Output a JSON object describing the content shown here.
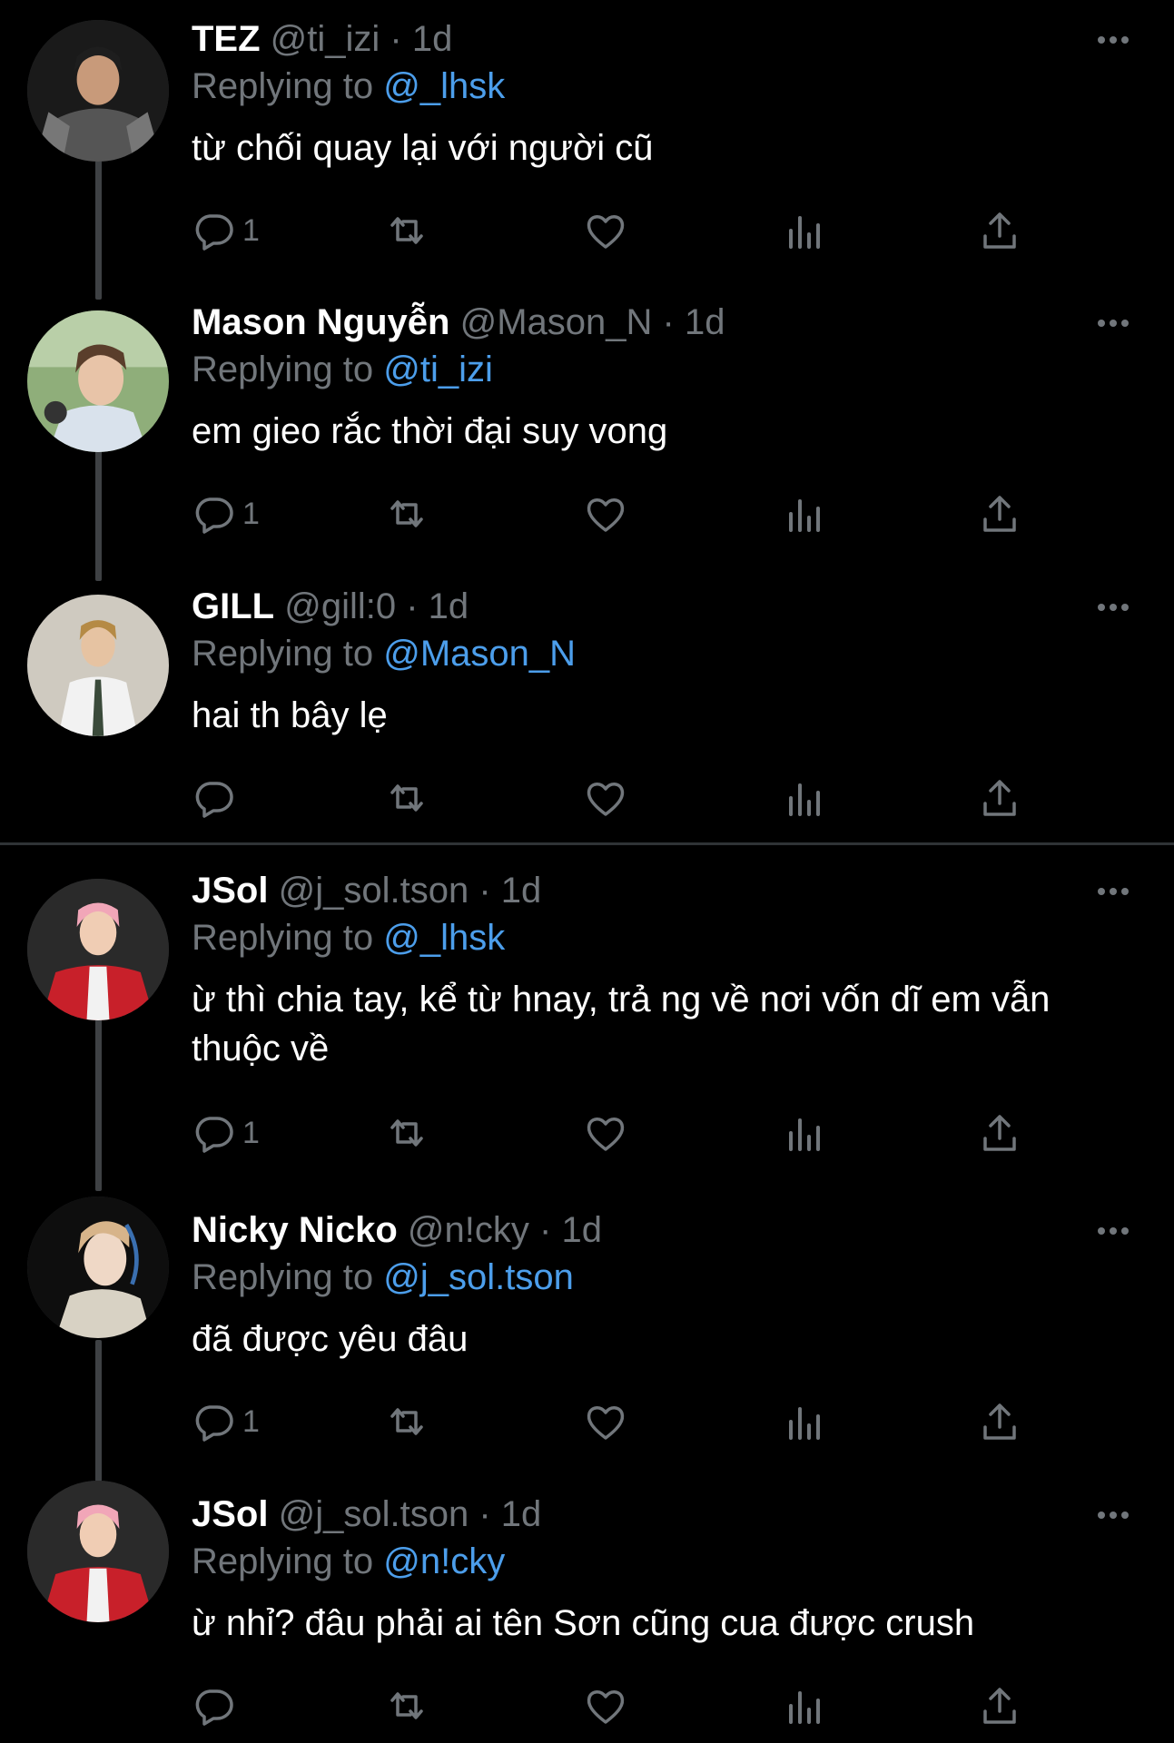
{
  "colors": {
    "background": "#000000",
    "text": "#ffffff",
    "secondary": "#71767b",
    "accent": "#4c9eeb",
    "thread_line": "#3e4144"
  },
  "tweets": [
    {
      "name": "TEZ",
      "handle": "@ti_izi",
      "separator": "·",
      "time": "1d",
      "replying_label": "Replying to",
      "replying_to": "@_lhsk",
      "text": "từ chối quay lại với người cũ",
      "reply_count": "1",
      "avatar_icon": "avatar-photo-icon"
    },
    {
      "name": "Mason Nguyễn",
      "handle": "@Mason_N",
      "separator": "·",
      "time": "1d",
      "replying_label": "Replying to",
      "replying_to": "@ti_izi",
      "text": "em gieo rắc thời đại suy vong",
      "reply_count": "1",
      "avatar_icon": "avatar-photo-icon"
    },
    {
      "name": "GILL",
      "handle": "@gill:0",
      "separator": "·",
      "time": "1d",
      "replying_label": "Replying to",
      "replying_to": "@Mason_N",
      "text": "hai th bây lẹ",
      "reply_count": "",
      "avatar_icon": "avatar-photo-icon"
    },
    {
      "name": "JSol",
      "handle": "@j_sol.tson",
      "separator": "·",
      "time": "1d",
      "replying_label": "Replying to",
      "replying_to": "@_lhsk",
      "text": "ừ thì chia tay, kể từ hnay, trả ng về nơi vốn dĩ em vẫn thuộc về",
      "reply_count": "1",
      "avatar_icon": "avatar-photo-icon"
    },
    {
      "name": "Nicky Nicko",
      "handle": "@n!cky",
      "separator": "·",
      "time": "1d",
      "replying_label": "Replying to",
      "replying_to": "@j_sol.tson",
      "text": "đã được yêu đâu",
      "reply_count": "1",
      "avatar_icon": "avatar-photo-icon"
    },
    {
      "name": "JSol",
      "handle": "@j_sol.tson",
      "separator": "·",
      "time": "1d",
      "replying_label": "Replying to",
      "replying_to": "@n!cky",
      "text": "ừ nhỉ? đâu phải ai tên Sơn cũng cua được crush",
      "reply_count": "",
      "avatar_icon": "avatar-photo-icon"
    }
  ]
}
